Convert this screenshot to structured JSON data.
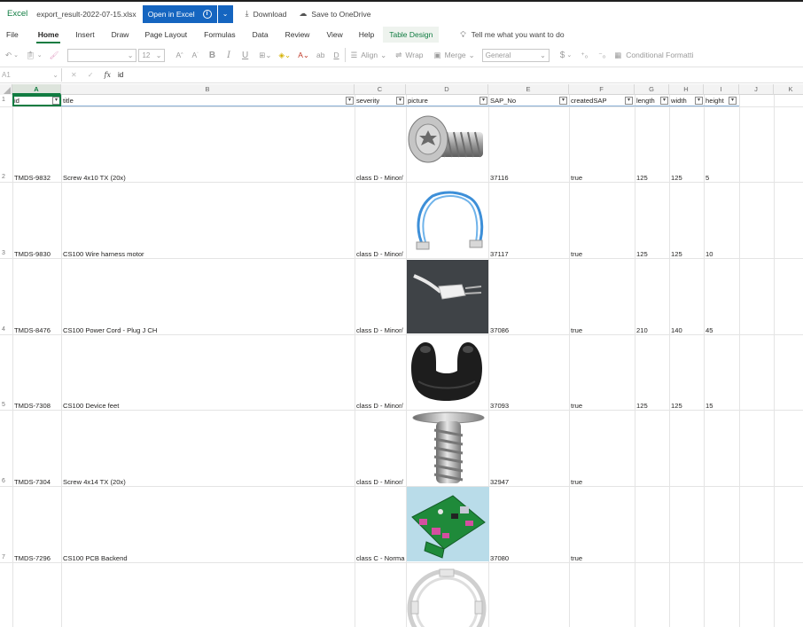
{
  "topbar": {
    "app_name": "Excel",
    "file_name": "export_result-2022-07-15.xlsx",
    "open_label": "Open in Excel",
    "download_label": "Download",
    "onedrive_label": "Save to OneDrive"
  },
  "tabs": [
    "File",
    "Home",
    "Insert",
    "Draw",
    "Page Layout",
    "Formulas",
    "Data",
    "Review",
    "View",
    "Help",
    "Table Design"
  ],
  "tell_me": "Tell me what you want to do",
  "toolbar": {
    "font_size": "12",
    "align_label": "Align",
    "wrap_label": "Wrap",
    "merge_label": "Merge",
    "number_format": "General",
    "currency_symbol": "$",
    "conditional_label": "Conditional Formatti"
  },
  "formula_bar": {
    "name_box": "A1",
    "value": "id"
  },
  "columns": [
    "A",
    "B",
    "C",
    "D",
    "E",
    "F",
    "G",
    "H",
    "I",
    "J",
    "K"
  ],
  "headers": [
    "id",
    "title",
    "severity",
    "picture",
    "SAP_No",
    "createdSAP",
    "length",
    "width",
    "height"
  ],
  "rows": [
    {
      "num": "2",
      "id": "TMDS-9832",
      "title": "Screw 4x10 TX (20x)",
      "severity": "class D - Minor/",
      "sap": "37116",
      "created": "true",
      "length": "125",
      "width": "125",
      "height": "5",
      "picture": "screw-image"
    },
    {
      "num": "3",
      "id": "TMDS-9830",
      "title": "CS100 Wire harness motor",
      "severity": "class D - Minor/",
      "sap": "37117",
      "created": "true",
      "length": "125",
      "width": "125",
      "height": "10",
      "picture": "wire-harness-image"
    },
    {
      "num": "4",
      "id": "TMDS-8476",
      "title": "CS100 Power Cord - Plug J CH",
      "severity": "class D - Minor/",
      "sap": "37086",
      "created": "true",
      "length": "210",
      "width": "140",
      "height": "45",
      "picture": "power-cord-image"
    },
    {
      "num": "5",
      "id": "TMDS-7308",
      "title": "CS100 Device feet",
      "severity": "class D - Minor/",
      "sap": "37093",
      "created": "true",
      "length": "125",
      "width": "125",
      "height": "15",
      "picture": "device-feet-image"
    },
    {
      "num": "6",
      "id": "TMDS-7304",
      "title": "Screw 4x14 TX (20x)",
      "severity": "class D - Minor/",
      "sap": "32947",
      "created": "true",
      "length": "",
      "width": "",
      "height": "",
      "picture": "screw-long-image"
    },
    {
      "num": "7",
      "id": "TMDS-7296",
      "title": "CS100 PCB Backend",
      "severity": "class C - Norma",
      "sap": "37080",
      "created": "true",
      "length": "",
      "width": "",
      "height": "",
      "picture": "pcb-image"
    }
  ],
  "colors": {
    "accent_green": "#107c41",
    "open_button_blue": "#1565c0"
  }
}
